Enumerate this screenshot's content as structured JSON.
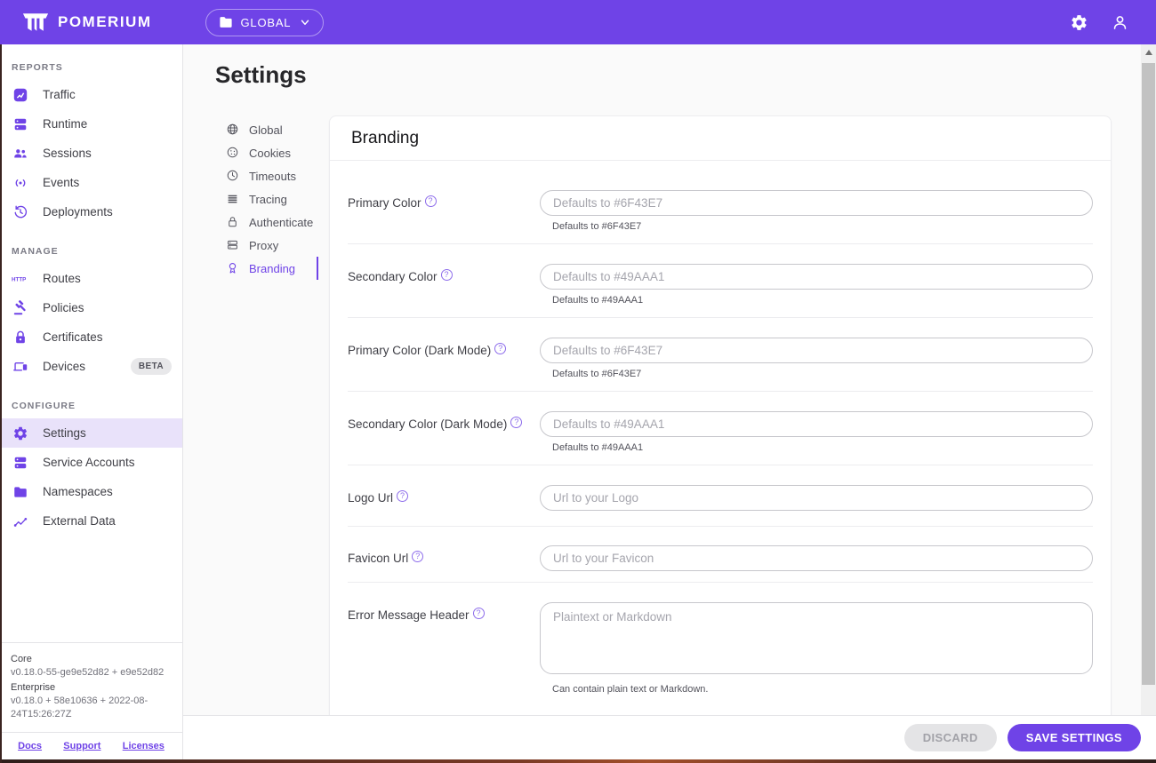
{
  "header": {
    "brand": "POMERIUM",
    "namespace": {
      "label": "GLOBAL",
      "icon": "folder-icon",
      "chevron_icon": "chevron-down-icon"
    },
    "right_icons": [
      "gear-icon",
      "user-icon"
    ]
  },
  "sidebar": {
    "sections": [
      {
        "title": "REPORTS",
        "items": [
          {
            "label": "Traffic",
            "icon": "traffic-chart-icon"
          },
          {
            "label": "Runtime",
            "icon": "runtime-server-icon"
          },
          {
            "label": "Sessions",
            "icon": "sessions-people-icon"
          },
          {
            "label": "Events",
            "icon": "events-broadcast-icon"
          },
          {
            "label": "Deployments",
            "icon": "deployments-history-icon"
          }
        ]
      },
      {
        "title": "MANAGE",
        "items": [
          {
            "label": "Routes",
            "icon": "routes-http-icon"
          },
          {
            "label": "Policies",
            "icon": "policies-gavel-icon"
          },
          {
            "label": "Certificates",
            "icon": "certificates-lock-icon"
          },
          {
            "label": "Devices",
            "icon": "devices-icon",
            "badge": "BETA"
          }
        ]
      },
      {
        "title": "CONFIGURE",
        "items": [
          {
            "label": "Settings",
            "icon": "settings-gear-icon",
            "selected": true
          },
          {
            "label": "Service Accounts",
            "icon": "service-accounts-icon"
          },
          {
            "label": "Namespaces",
            "icon": "namespaces-folder-icon"
          },
          {
            "label": "External Data",
            "icon": "external-data-icon"
          }
        ]
      }
    ],
    "version": {
      "core_label": "Core",
      "core_value": "v0.18.0-55-ge9e52d82 + e9e52d82",
      "enterprise_label": "Enterprise",
      "enterprise_value": "v0.18.0 + 58e10636 + 2022-08-24T15:26:27Z"
    },
    "links": [
      {
        "label": "Docs"
      },
      {
        "label": "Support"
      },
      {
        "label": "Licenses"
      }
    ]
  },
  "page": {
    "title": "Settings",
    "tabs": [
      {
        "label": "Global",
        "icon": "globe-icon"
      },
      {
        "label": "Cookies",
        "icon": "cookie-icon"
      },
      {
        "label": "Timeouts",
        "icon": "clock-icon"
      },
      {
        "label": "Tracing",
        "icon": "tracing-lines-icon"
      },
      {
        "label": "Authenticate",
        "icon": "lock-icon"
      },
      {
        "label": "Proxy",
        "icon": "proxy-server-icon"
      },
      {
        "label": "Branding",
        "icon": "award-ribbon-icon",
        "selected": true
      }
    ],
    "card": {
      "title": "Branding",
      "fields": [
        {
          "label": "Primary Color",
          "placeholder": "Defaults to #6F43E7",
          "helper": "Defaults to #6F43E7"
        },
        {
          "label": "Secondary Color",
          "placeholder": "Defaults to #49AAA1",
          "helper": "Defaults to #49AAA1"
        },
        {
          "label": "Primary Color (Dark Mode)",
          "placeholder": "Defaults to #6F43E7",
          "helper": "Defaults to #6F43E7"
        },
        {
          "label": "Secondary Color (Dark Mode)",
          "placeholder": "Defaults to #49AAA1",
          "helper": "Defaults to #49AAA1"
        },
        {
          "label": "Logo Url",
          "placeholder": "Url to your Logo"
        },
        {
          "label": "Favicon Url",
          "placeholder": "Url to your Favicon"
        },
        {
          "label": "Error Message Header",
          "placeholder": "Plaintext or Markdown",
          "helper": "Can contain plain text or Markdown."
        }
      ]
    },
    "actions": {
      "discard": "DISCARD",
      "save": "SAVE SETTINGS"
    }
  },
  "colors": {
    "brand_primary": "#6F43E7",
    "brand_secondary_default": "#49AAA1",
    "header_bg": "#6F43E7",
    "selected_row_bg": "#E9E2FA",
    "link": "#6F43E7"
  }
}
